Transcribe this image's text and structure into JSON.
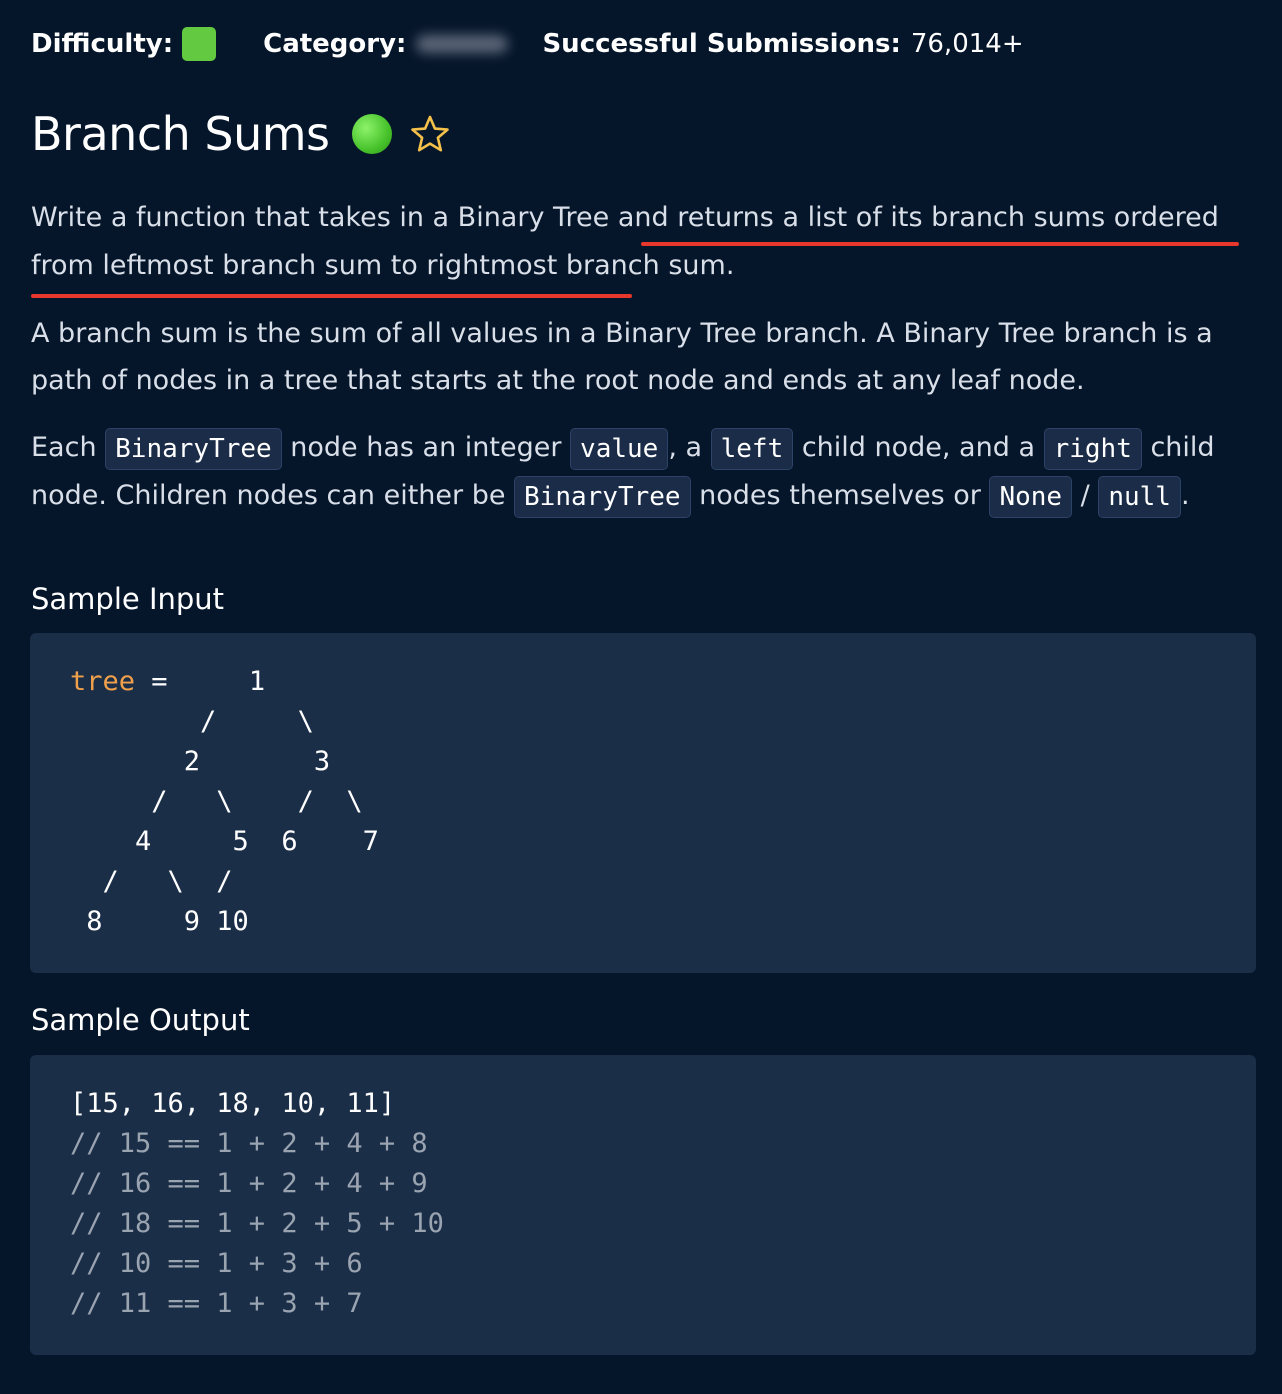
{
  "stats": {
    "difficulty_label": "Difficulty:",
    "difficulty_color": "#63c940",
    "category_label": "Category:",
    "submissions_label": "Successful Submissions:",
    "submissions_value": "76,014+"
  },
  "title": "Branch Sums",
  "description": {
    "p1_a": "Write a function that takes in a Binary Tree and ",
    "p1_b": "returns a list of its branch sums ordered from leftmost branch sum to rightmost branch sum",
    "p1_c": ".",
    "p2": "A branch sum is the sum of all values in a Binary Tree branch. A Binary Tree branch is a path of nodes in a tree that starts at the root node and ends at any leaf node.",
    "p3": {
      "t1": "Each ",
      "c1": "BinaryTree",
      "t2": " node has an integer ",
      "c2": "value",
      "t3": ", a ",
      "c3": "left",
      "t4": " child node, and a ",
      "c4": "right",
      "t5": " child node. Children nodes can either be ",
      "c5": "BinaryTree",
      "t6": " nodes themselves or ",
      "c6": "None",
      "t7": " / ",
      "c7": "null",
      "t8": "."
    }
  },
  "sample_input": {
    "heading": "Sample Input",
    "keyword": "tree",
    "lines": [
      " =     1",
      "        /     \\",
      "       2       3",
      "     /   \\    /  \\",
      "    4     5  6    7",
      "  /   \\  /",
      " 8     9 10"
    ]
  },
  "sample_output": {
    "heading": "Sample Output",
    "result": "[15, 16, 18, 10, 11]",
    "comments": [
      "// 15 == 1 + 2 + 4 + 8",
      "// 16 == 1 + 2 + 4 + 9",
      "// 18 == 1 + 2 + 5 + 10",
      "// 10 == 1 + 3 + 6",
      "// 11 == 1 + 3 + 7"
    ]
  },
  "colors": {
    "background": "#05152a",
    "code_block": "#1b2e48",
    "underline": "#e8372c",
    "keyword": "#f0a04b",
    "star": "#f5c14a"
  }
}
